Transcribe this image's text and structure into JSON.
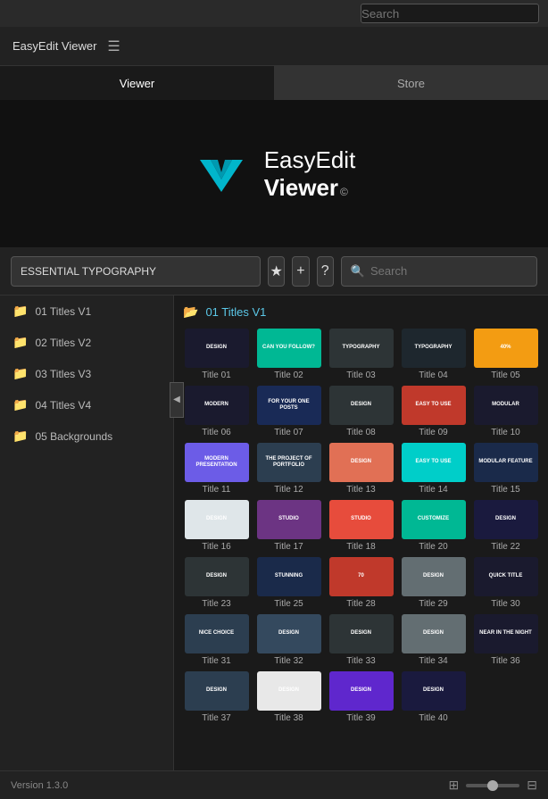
{
  "topbar": {
    "search_placeholder": "Search"
  },
  "appbar": {
    "title": "EasyEdit Viewer",
    "menu_icon": "☰"
  },
  "tabs": [
    {
      "id": "viewer",
      "label": "Viewer",
      "active": true
    },
    {
      "id": "store",
      "label": "Store",
      "active": false
    }
  ],
  "hero": {
    "logo_top": "EasyEdit",
    "logo_bottom": "Viewer",
    "logo_copy": "©"
  },
  "toolbar": {
    "dropdown_value": "ESSENTIAL TYPOGRAPHY",
    "star_label": "★",
    "plus_label": "+",
    "question_label": "?",
    "search_placeholder": "Search"
  },
  "sidebar": {
    "items": [
      {
        "id": "01-titles-v1",
        "label": "01 Titles V1"
      },
      {
        "id": "02-titles-v2",
        "label": "02 Titles V2"
      },
      {
        "id": "03-titles-v3",
        "label": "03 Titles V3"
      },
      {
        "id": "04-titles-v4",
        "label": "04 Titles V4"
      },
      {
        "id": "05-backgrounds",
        "label": "05 Backgrounds"
      }
    ]
  },
  "content": {
    "header": "01 Titles V1",
    "thumbnails": [
      {
        "id": 1,
        "label": "Title 01",
        "color_class": "t1",
        "text": "DESIGN"
      },
      {
        "id": 2,
        "label": "Title 02",
        "color_class": "t2",
        "text": "CAN YOU\nFOLLOW?"
      },
      {
        "id": 3,
        "label": "Title 03",
        "color_class": "t3",
        "text": "TYPOGRAPHY"
      },
      {
        "id": 4,
        "label": "Title 04",
        "color_class": "t4",
        "text": "TYPOGRAPHY"
      },
      {
        "id": 5,
        "label": "Title 05",
        "color_class": "t5",
        "text": "40%"
      },
      {
        "id": 6,
        "label": "Title 06",
        "color_class": "t6",
        "text": "MODERN"
      },
      {
        "id": 7,
        "label": "Title 07",
        "color_class": "t7",
        "text": "FOR YOUR\nONE POSTS"
      },
      {
        "id": 8,
        "label": "Title 08",
        "color_class": "t8",
        "text": "DESIGN"
      },
      {
        "id": 9,
        "label": "Title 09",
        "color_class": "t9",
        "text": "EASY TO USE"
      },
      {
        "id": 10,
        "label": "Title 10",
        "color_class": "t10",
        "text": "MODULAR"
      },
      {
        "id": 11,
        "label": "Title 11",
        "color_class": "t11",
        "text": "MODERN\nPRESENTATION"
      },
      {
        "id": 12,
        "label": "Title 12",
        "color_class": "t12",
        "text": "THE PROJECT\nOF PORTFOLIO"
      },
      {
        "id": 13,
        "label": "Title 13",
        "color_class": "t13",
        "text": "DESIGN"
      },
      {
        "id": 14,
        "label": "Title 14",
        "color_class": "t14",
        "text": "EASY TO USE"
      },
      {
        "id": 15,
        "label": "Title 15",
        "color_class": "t15",
        "text": "MODULAR\nFEATURE"
      },
      {
        "id": 16,
        "label": "Title 16",
        "color_class": "t16",
        "text": "DESIGN"
      },
      {
        "id": 17,
        "label": "Title 17",
        "color_class": "t17",
        "text": "STUDIO"
      },
      {
        "id": 18,
        "label": "Title 18",
        "color_class": "t18",
        "text": "STUDIO"
      },
      {
        "id": 20,
        "label": "Title 20",
        "color_class": "t20",
        "text": "CUSTOMIZE"
      },
      {
        "id": 22,
        "label": "Title 22",
        "color_class": "t22",
        "text": "DESIGN"
      },
      {
        "id": 23,
        "label": "Title 23",
        "color_class": "t23",
        "text": "DESIGN"
      },
      {
        "id": 25,
        "label": "Title 25",
        "color_class": "t25",
        "text": "STUNNING"
      },
      {
        "id": 28,
        "label": "Title 28",
        "color_class": "t28",
        "text": "70"
      },
      {
        "id": 29,
        "label": "Title 29",
        "color_class": "t29",
        "text": "DESIGN"
      },
      {
        "id": 30,
        "label": "Title 30",
        "color_class": "t30",
        "text": "QUICK\nTITLE"
      },
      {
        "id": 31,
        "label": "Title 31",
        "color_class": "t31",
        "text": "NICE CHOICE"
      },
      {
        "id": 32,
        "label": "Title 32",
        "color_class": "t32",
        "text": "DESIGN"
      },
      {
        "id": 33,
        "label": "Title 33",
        "color_class": "t33",
        "text": "DESIGN"
      },
      {
        "id": 34,
        "label": "Title 34",
        "color_class": "t34",
        "text": "DESIGN"
      },
      {
        "id": 36,
        "label": "Title 36",
        "color_class": "t36",
        "text": "NEAR IN\nTHE NIGHT"
      },
      {
        "id": 37,
        "label": "Title 37",
        "color_class": "t37",
        "text": "DESIGN"
      },
      {
        "id": 38,
        "label": "Title 38",
        "color_class": "t38",
        "text": "DESIGN"
      },
      {
        "id": 39,
        "label": "Title 39",
        "color_class": "t39",
        "text": "DESIGN"
      },
      {
        "id": 40,
        "label": "Title 40",
        "color_class": "t40",
        "text": "DESIGN"
      }
    ]
  },
  "statusbar": {
    "version": "Version 1.3.0"
  }
}
